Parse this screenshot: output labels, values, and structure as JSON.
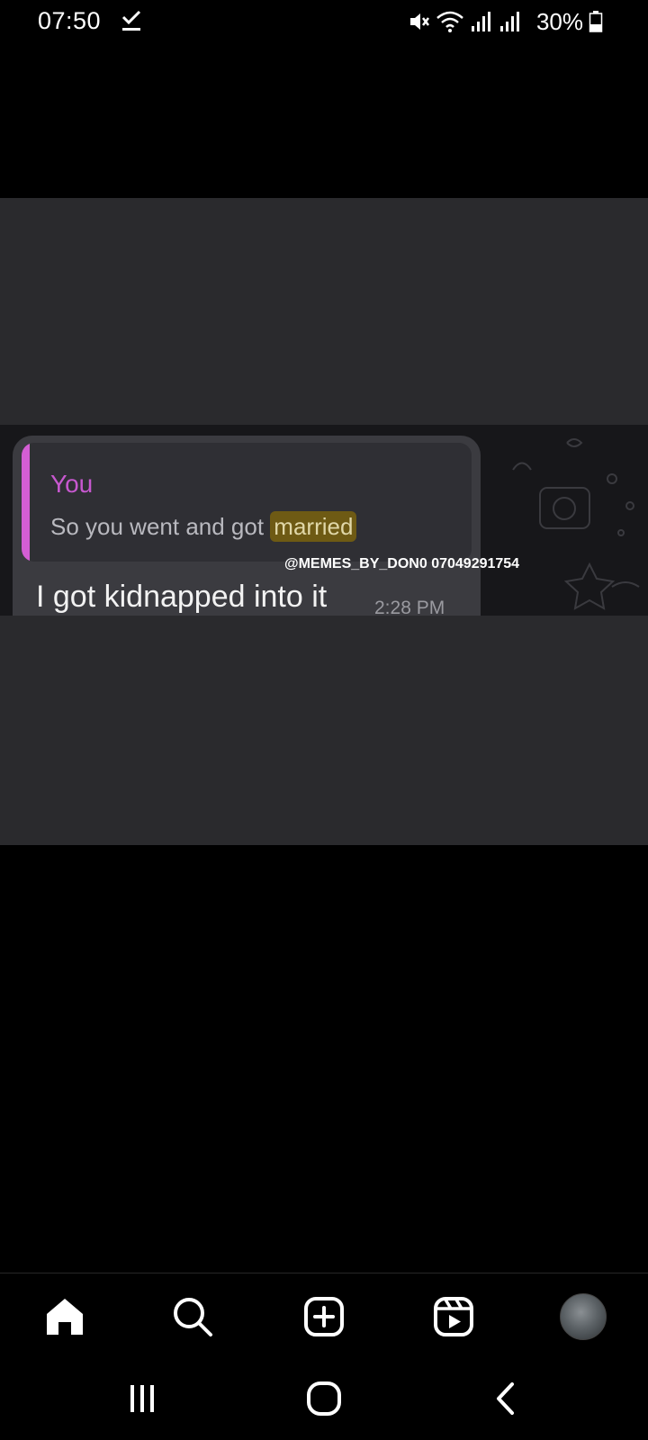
{
  "status_bar": {
    "time": "07:50",
    "battery": "30%",
    "icons": [
      "download-done-icon",
      "mute-icon",
      "wifi-icon",
      "signal-icon",
      "signal-icon",
      "battery-icon"
    ]
  },
  "post": {
    "chat": {
      "reply_author": "You",
      "reply_text_before": "So you went and got ",
      "reply_text_highlight": "married",
      "message": "I got kidnapped into it",
      "time": "2:28 PM",
      "watermark": "@MEMES_BY_DON0 07049291754"
    }
  },
  "bottom_nav": {
    "items": [
      "home-icon",
      "search-icon",
      "create-icon",
      "reels-icon",
      "profile-avatar"
    ]
  },
  "system_nav": {
    "items": [
      "recents-icon",
      "home-circle-icon",
      "back-icon"
    ]
  },
  "colors": {
    "reply_accent": "#c758cf",
    "highlight": "#6e5a14",
    "background": "#000000"
  }
}
